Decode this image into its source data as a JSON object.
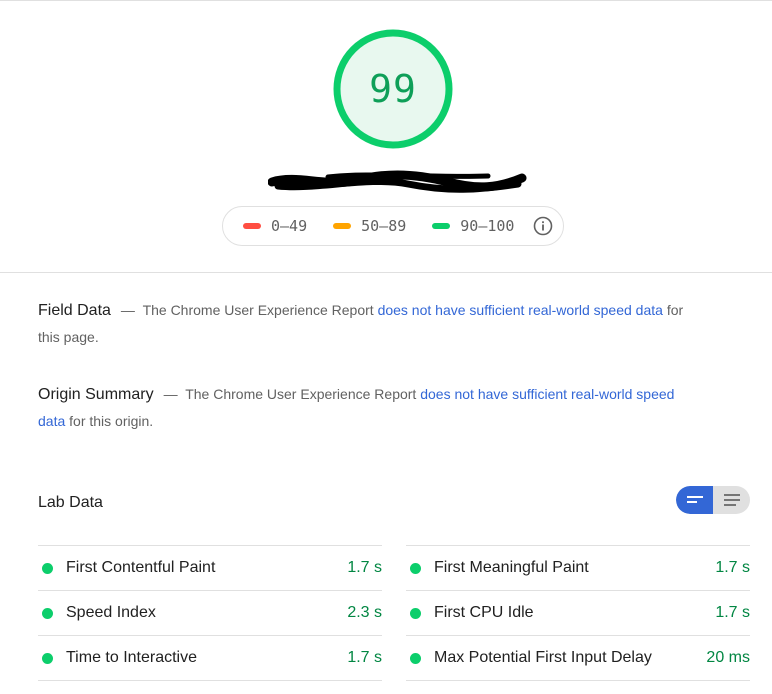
{
  "score": {
    "value": "99",
    "color_ring": "#0cce6b",
    "color_fill": "#e8f8ef",
    "color_text": "#0e9f58"
  },
  "legend": {
    "items": [
      {
        "range": "0–49",
        "color": "#ff4e42"
      },
      {
        "range": "50–89",
        "color": "#ffa400"
      },
      {
        "range": "90–100",
        "color": "#0cce6b"
      }
    ],
    "info_icon": "info-icon"
  },
  "field_data": {
    "heading": "Field Data",
    "dash": "—",
    "text_before": "The Chrome User Experience Report",
    "link": "does not have sufficient real-world speed data",
    "text_after": "for this page."
  },
  "origin_summary": {
    "heading": "Origin Summary",
    "dash": "—",
    "text_before": "The Chrome User Experience Report",
    "link": "does not have sufficient real-world speed data",
    "text_after": "for this origin."
  },
  "lab_data": {
    "title": "Lab Data",
    "toggle": {
      "active": "summary-view",
      "inactive": "description-view",
      "accent": "#3367d6"
    },
    "metrics_left": [
      {
        "name": "First Contentful Paint",
        "value": "1.7 s"
      },
      {
        "name": "Speed Index",
        "value": "2.3 s"
      },
      {
        "name": "Time to Interactive",
        "value": "1.7 s"
      }
    ],
    "metrics_right": [
      {
        "name": "First Meaningful Paint",
        "value": "1.7 s"
      },
      {
        "name": "First CPU Idle",
        "value": "1.7 s"
      },
      {
        "name": "Max Potential First Input Delay",
        "value": "20 ms"
      }
    ],
    "pass_color": "#0cce6b"
  }
}
